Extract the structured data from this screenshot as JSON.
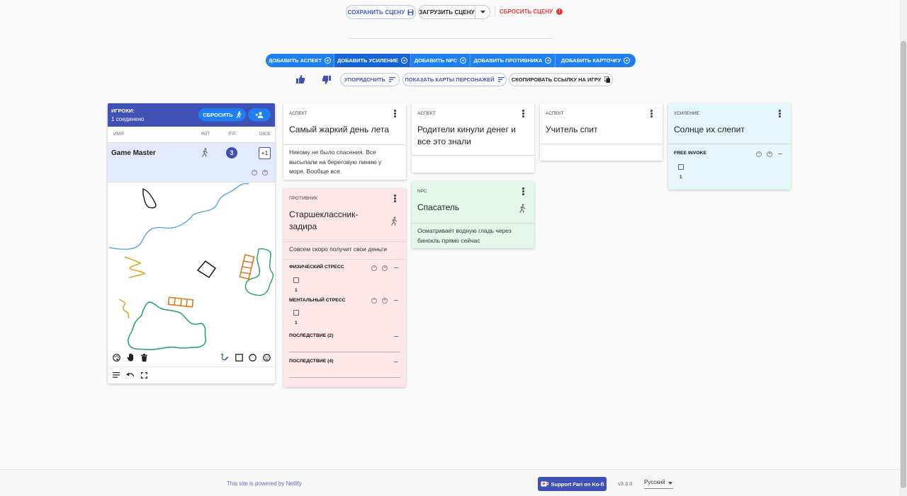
{
  "toolbar": {
    "save_scene": "Сохранить сцену",
    "load_scene": "Загрузить сцену",
    "reset_scene": "Сбросить сцену",
    "reset_scene_badge": "!"
  },
  "add_buttons": [
    {
      "label": "Добавить аспект"
    },
    {
      "label": "Добавить усиление"
    },
    {
      "label": "Добавить NPC"
    },
    {
      "label": "Добавить противника"
    },
    {
      "label": "Добавить карточку"
    }
  ],
  "actions": {
    "sort": "Упорядочить",
    "show_character_cards": "Показать карты персонажей",
    "copy_link": "Скопировать ссылку на игру"
  },
  "players": {
    "title": "Игроки:",
    "connected": "1 соединено",
    "reset_label": "Сбросить",
    "columns": {
      "name": "Имя",
      "init": "Init",
      "fp": "F.P.",
      "dice": "Dice"
    },
    "rows": [
      {
        "name": "Game Master",
        "fate_points": "3",
        "dice": "+1"
      }
    ]
  },
  "cards": {
    "aspect1": {
      "type": "Аспект",
      "title": "Самый жаркий день лета",
      "body": "Никому не было спасения. Все высыпали на береговую линию у моря. Вообще все."
    },
    "aspect2": {
      "type": "Аспект",
      "title": "Родители кинули денег и все это знали",
      "body": ""
    },
    "aspect3": {
      "type": "Аспект",
      "title": "Учитель спит",
      "body": ""
    },
    "boost": {
      "type": "Усиление",
      "title": "Солнце их слепит",
      "track_label": "Free Invoke",
      "box_num": "1"
    },
    "enemy": {
      "type": "Противник",
      "title": "Старшеклассник-задира",
      "body": "Совсем скоро получит свои деньги",
      "track1_label": "Физический стресс",
      "track1_num": "1",
      "track2_label": "Ментальный стресс",
      "track2_num": "1",
      "cons1_label": "Последствие (2)",
      "cons2_label": "Последствие (4)"
    },
    "npc": {
      "type": "NPC",
      "title": "Спасатель",
      "body": "Осматривает водную гладь через бинокль прямо сейчас"
    }
  },
  "footer": {
    "powered": "This site is powered by Netlify",
    "kofi": "Support Fari on Ko-fi",
    "version": "v3.3.0",
    "language": "Русский"
  },
  "colors": {
    "primary": "#1e7ff0",
    "indigo": "#3f51b5",
    "enemy_bg": "#fde7e7",
    "npc_bg": "#e4f8ea",
    "boost_bg": "#e6f7fb",
    "danger": "#e53935"
  }
}
